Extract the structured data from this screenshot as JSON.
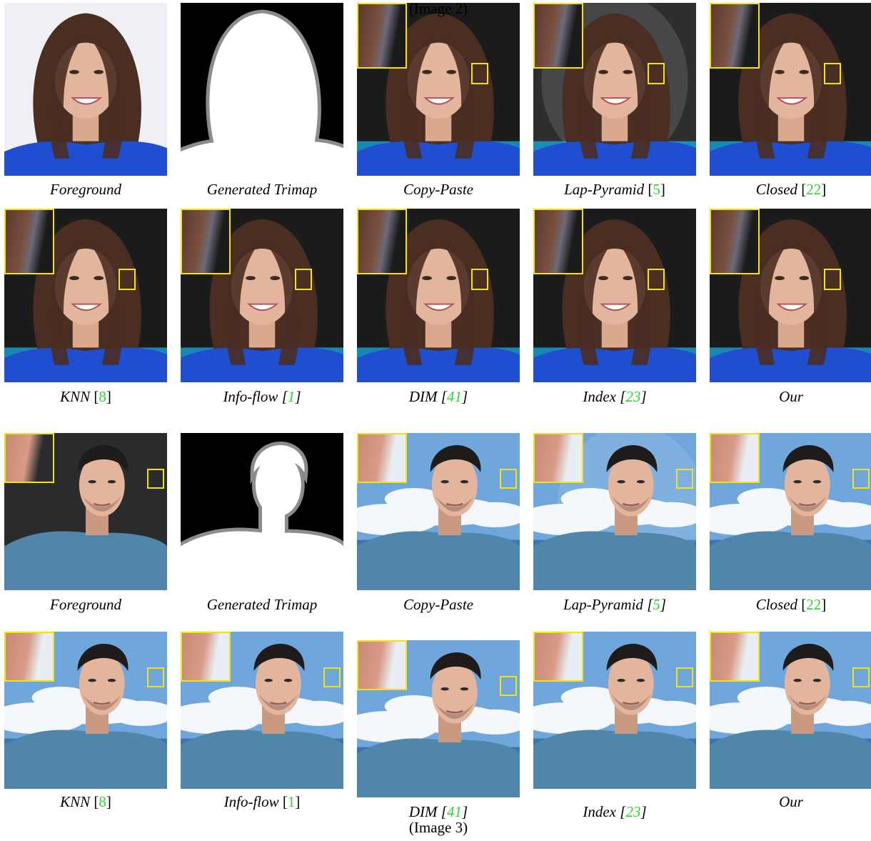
{
  "rows": [
    {
      "id": "r1",
      "kind": "woman",
      "tiles": [
        {
          "variant": "foreground",
          "bg": "#efeff5"
        },
        {
          "variant": "trimap",
          "subject": "woman"
        },
        {
          "variant": "composite",
          "bg": "#1b1b1c",
          "halo": false,
          "inset": true
        },
        {
          "variant": "composite",
          "bg": "#2e2e30",
          "halo": true,
          "inset": true
        },
        {
          "variant": "composite",
          "bg": "#1b1b1c",
          "halo": false,
          "inset": true
        }
      ],
      "captions": [
        {
          "method": "Foreground",
          "ref": "",
          "ref_italic": false
        },
        {
          "method": "Generated Trimap",
          "ref": "",
          "ref_italic": false
        },
        {
          "method": "Copy-Paste",
          "ref": "",
          "ref_italic": false
        },
        {
          "method": "Lap-Pyramid",
          "ref": "5",
          "ref_italic": false
        },
        {
          "method": "Closed",
          "ref": "22",
          "ref_italic": false
        }
      ]
    },
    {
      "id": "r2",
      "kind": "woman",
      "tiles": [
        {
          "variant": "composite",
          "bg": "#1b1b1c",
          "halo": false,
          "inset": true
        },
        {
          "variant": "composite",
          "bg": "#1b1b1c",
          "halo": false,
          "inset": true
        },
        {
          "variant": "composite",
          "bg": "#1b1b1c",
          "halo": false,
          "inset": true
        },
        {
          "variant": "composite",
          "bg": "#1b1b1c",
          "halo": false,
          "inset": true
        },
        {
          "variant": "composite",
          "bg": "#1b1b1c",
          "halo": false,
          "inset": true
        }
      ],
      "captions": [
        {
          "method": "KNN",
          "ref": "8",
          "ref_italic": false
        },
        {
          "method": "Info-flow",
          "ref": "1",
          "ref_italic": true
        },
        {
          "method": "DIM",
          "ref": "41",
          "ref_italic": true
        },
        {
          "method": "Index",
          "ref": "23",
          "ref_italic": true
        },
        {
          "method": "Our",
          "ref": "",
          "ref_italic": false
        }
      ],
      "group_label": "(Image 2)"
    },
    {
      "id": "r3",
      "kind": "man",
      "tiles": [
        {
          "variant": "foreground",
          "bg": "#2a2b2d"
        },
        {
          "variant": "trimap",
          "subject": "man"
        },
        {
          "variant": "composite",
          "bg": "sky",
          "halo": false,
          "inset": true
        },
        {
          "variant": "composite",
          "bg": "sky",
          "halo": true,
          "inset": true
        },
        {
          "variant": "composite",
          "bg": "sky",
          "halo": false,
          "inset": true
        }
      ],
      "captions": [
        {
          "method": "Foreground",
          "ref": "",
          "ref_italic": false
        },
        {
          "method": "Generated Trimap",
          "ref": "",
          "ref_italic": false
        },
        {
          "method": "Copy-Paste",
          "ref": "",
          "ref_italic": false
        },
        {
          "method": "Lap-Pyramid",
          "ref": "5",
          "ref_italic": true
        },
        {
          "method": "Closed",
          "ref": "22",
          "ref_italic": false
        }
      ]
    },
    {
      "id": "r4",
      "kind": "man",
      "tiles": [
        {
          "variant": "composite",
          "bg": "sky",
          "halo": false,
          "inset": true
        },
        {
          "variant": "composite",
          "bg": "sky",
          "halo": false,
          "inset": true
        },
        {
          "variant": "composite",
          "bg": "sky",
          "halo": false,
          "inset": true
        },
        {
          "variant": "composite",
          "bg": "sky",
          "halo": false,
          "inset": true
        },
        {
          "variant": "composite",
          "bg": "sky",
          "halo": false,
          "inset": true
        }
      ],
      "captions": [
        {
          "method": "KNN",
          "ref": "8",
          "ref_italic": false
        },
        {
          "method": "Info-flow",
          "ref": "1",
          "ref_italic": false
        },
        {
          "method": "DIM",
          "ref": "41",
          "ref_italic": true
        },
        {
          "method": "Index",
          "ref": "23",
          "ref_italic": true
        },
        {
          "method": "Our",
          "ref": "",
          "ref_italic": false
        }
      ],
      "group_label": "(Image 3)"
    }
  ],
  "colors": {
    "shirt_woman": "#1f4ed0",
    "shirt_man": "#4f86aa",
    "hair_woman": "#4a2e22",
    "hair_man": "#1e1b1a",
    "skin": "#e3b59c",
    "inset_border": "#f2e21a",
    "ref_green": "#2ed62e",
    "sky": "#6fa6dc",
    "cloud": "#f4f7fb",
    "water": "#16a4d8"
  }
}
